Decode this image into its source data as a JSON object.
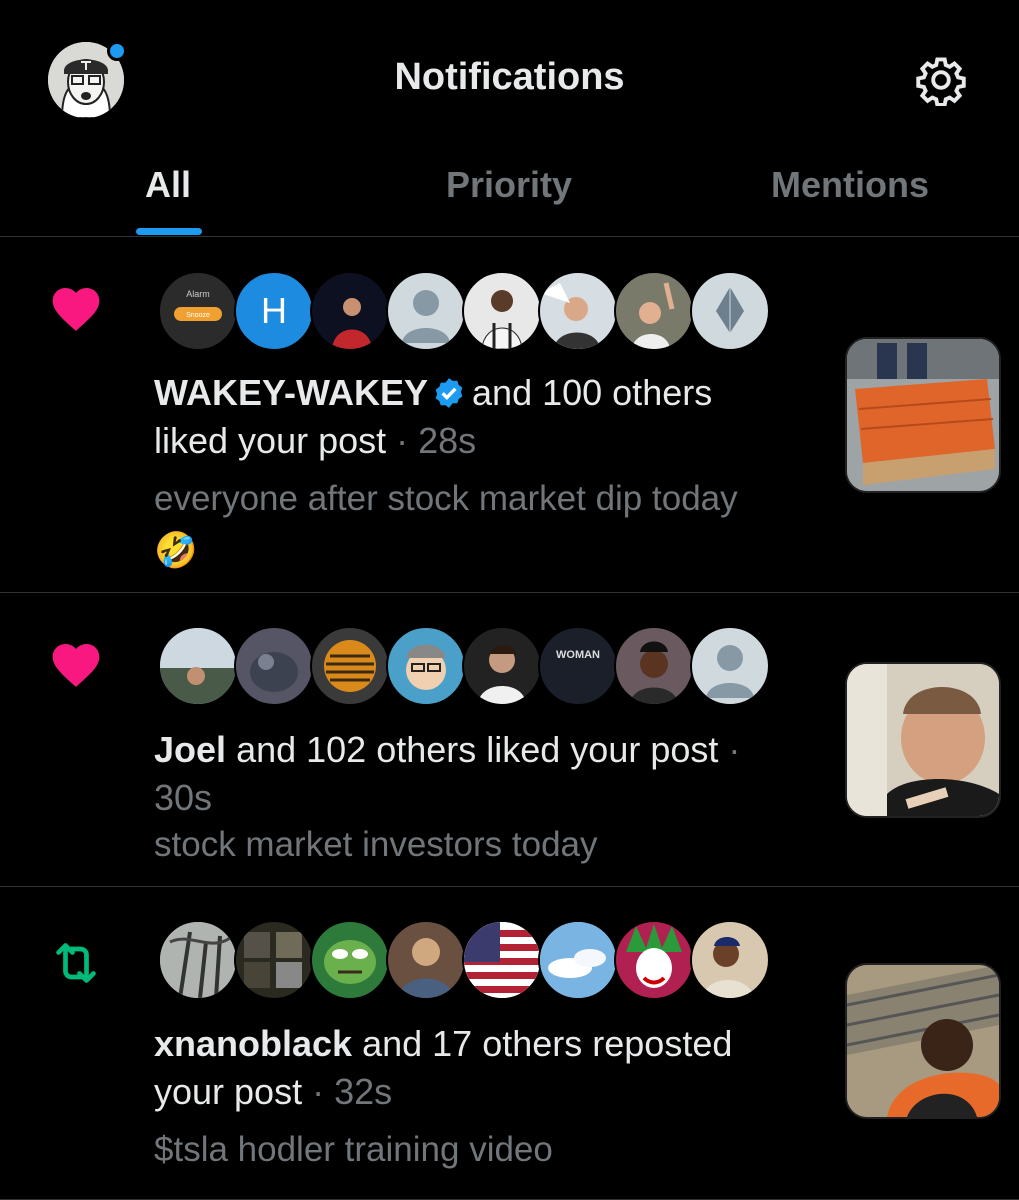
{
  "header": {
    "title": "Notifications",
    "settings_icon": "gear-icon"
  },
  "tabs": [
    {
      "label": "All",
      "active": true
    },
    {
      "label": "Priority",
      "active": false
    },
    {
      "label": "Mentions",
      "active": false
    }
  ],
  "notifications": [
    {
      "type": "like",
      "icon": "heart-icon",
      "actor": "WAKEY-WAKEY",
      "verified": true,
      "action_text": "and 100 others",
      "action_text_2": "liked your post",
      "time": "28s",
      "snippet": "everyone after stock market dip today",
      "emoji": "🤣",
      "avatar_letter": "H",
      "avatar_alarm_text": "Alarm",
      "avatar_snooze_text": "Snooze"
    },
    {
      "type": "like",
      "icon": "heart-icon",
      "actor": "Joel",
      "action_text": "and 102 others liked your post",
      "time": "30s",
      "snippet": "stock market investors today",
      "avatar_shirt_text": "WOMAN"
    },
    {
      "type": "repost",
      "icon": "repost-icon",
      "actor": "xnanoblack",
      "action_text": "and 17 others reposted",
      "action_text_2": "your post",
      "time": "32s",
      "snippet": "$tsla hodler training video"
    }
  ],
  "colors": {
    "background": "#000000",
    "accent": "#1d9bf0",
    "like": "#f91880",
    "repost": "#00ba7c",
    "muted": "#71767b"
  }
}
